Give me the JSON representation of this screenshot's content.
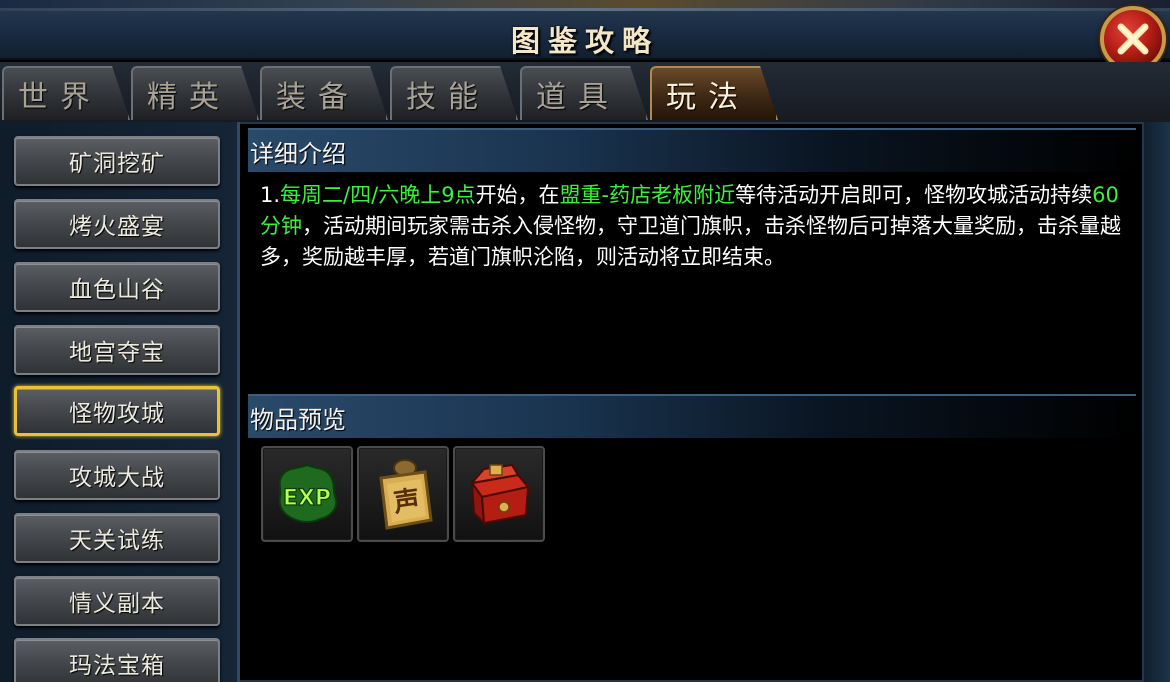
{
  "window": {
    "title": "图鉴攻略"
  },
  "tabs": [
    {
      "label": "世界",
      "active": false
    },
    {
      "label": "精英",
      "active": false
    },
    {
      "label": "装备",
      "active": false
    },
    {
      "label": "技能",
      "active": false
    },
    {
      "label": "道具",
      "active": false
    },
    {
      "label": "玩法",
      "active": true
    }
  ],
  "sidebar": {
    "items": [
      {
        "label": "矿洞挖矿"
      },
      {
        "label": "烤火盛宴"
      },
      {
        "label": "血色山谷"
      },
      {
        "label": "地宫夺宝"
      },
      {
        "label": "怪物攻城",
        "selected": true
      },
      {
        "label": "攻城大战"
      },
      {
        "label": "天关试练"
      },
      {
        "label": "情义副本"
      },
      {
        "label": "玛法宝箱"
      }
    ]
  },
  "detail": {
    "heading": "详细介绍",
    "parts": {
      "p1": "1.",
      "p2": "每周二/四/六晚上9点",
      "p3": "开始，在",
      "p4": "盟重-药店老板附近",
      "p5": "等待活动开启即可，怪物攻城活动持续",
      "p6": "60分钟",
      "p7": "，活动期间玩家需击杀入侵怪物，守卫道门旗帜，击杀怪物后可掉落大量奖励，击杀量越多，奖励越丰厚，若道门旗帜沦陷，则活动将立即结束。"
    }
  },
  "preview": {
    "heading": "物品预览",
    "items": [
      {
        "icon": "exp-icon",
        "text": "EXP"
      },
      {
        "icon": "reputation-token-icon",
        "text": "声"
      },
      {
        "icon": "red-treasure-box-icon"
      }
    ]
  },
  "colors": {
    "highlight": "#3cf03c",
    "selected_border": "#e8c23a",
    "active_tab": "#6a4a2a"
  }
}
